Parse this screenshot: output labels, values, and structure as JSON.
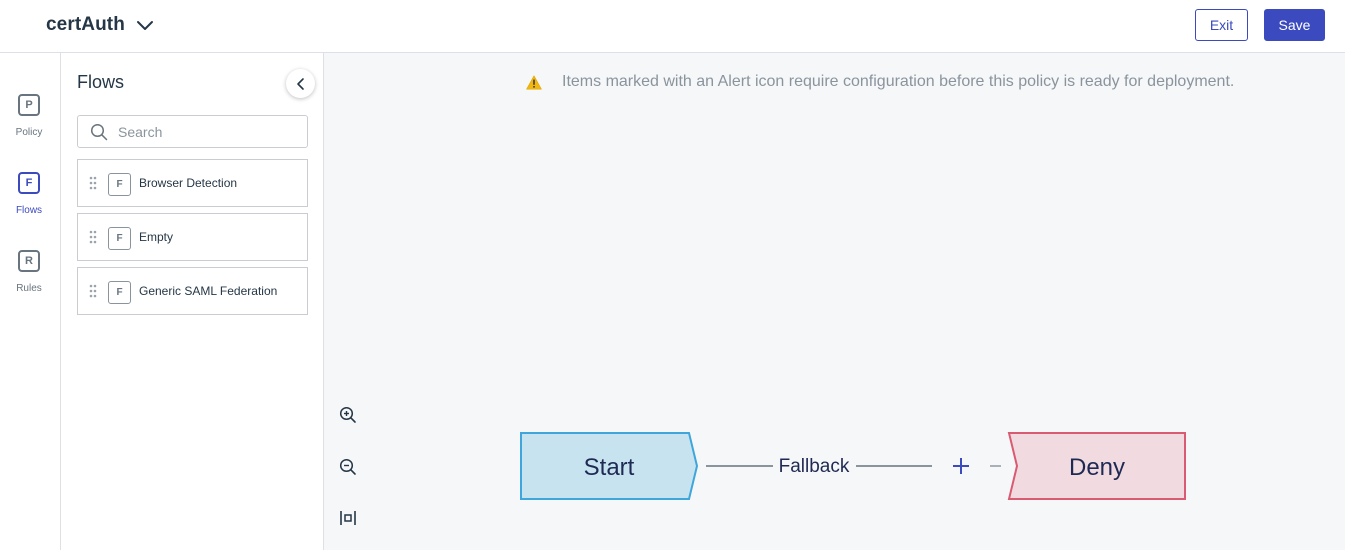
{
  "header": {
    "app_title": "certAuth",
    "exit_label": "Exit",
    "save_label": "Save",
    "accent_color": "#3b4bbf"
  },
  "rail": {
    "items": [
      {
        "badge": "P",
        "label": "Policy",
        "active": false
      },
      {
        "badge": "F",
        "label": "Flows",
        "active": true
      },
      {
        "badge": "R",
        "label": "Rules",
        "active": false
      }
    ]
  },
  "panel": {
    "title": "Flows",
    "search_placeholder": "Search",
    "flows": [
      {
        "badge": "F",
        "label": "Browser Detection"
      },
      {
        "badge": "F",
        "label": "Empty"
      },
      {
        "badge": "F",
        "label": "Generic SAML Federation"
      }
    ]
  },
  "canvas": {
    "alert_text": "Items marked with an Alert icon require configuration before this policy is ready for deployment.",
    "zoom_controls": [
      "zoom-in-icon",
      "zoom-out-icon",
      "fit-to-screen-icon"
    ],
    "start_node": {
      "label": "Start",
      "fill": "#c8e3f0",
      "stroke": "#3ea6da"
    },
    "edge_label": "Fallback",
    "add_symbol": "+",
    "end_node": {
      "label": "Deny",
      "fill": "#f2dbe0",
      "stroke": "#d95b72"
    }
  }
}
